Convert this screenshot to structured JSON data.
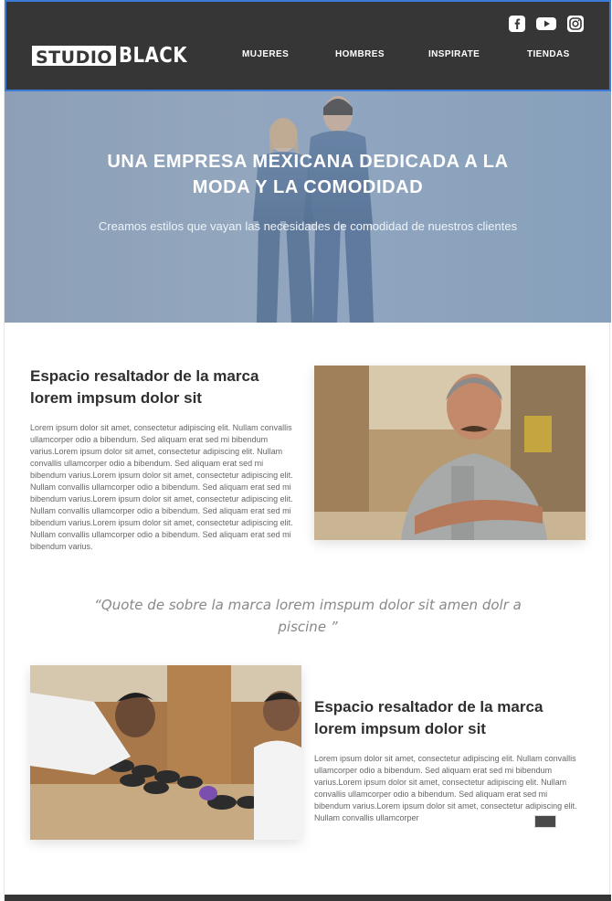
{
  "brand": {
    "logo_boxed": "STUDIO",
    "logo_rest": "BLACK"
  },
  "social": [
    {
      "name": "facebook-icon"
    },
    {
      "name": "youtube-icon"
    },
    {
      "name": "instagram-icon"
    }
  ],
  "nav": {
    "items": [
      "MUJERES",
      "HOMBRES",
      "INSPIRATE",
      "TIENDAS"
    ]
  },
  "hero": {
    "title_line1": "UNA EMPRESA MEXICANA DEDICADA A LA",
    "title_line2": "MODA Y LA COMODIDAD",
    "subtitle": "Creamos estilos que vayan las necesidades de comodidad de nuestros clientes"
  },
  "section1": {
    "heading_line1": "Espacio resaltador de la marca",
    "heading_line2": "lorem impsum dolor sit",
    "body": "Lorem ipsum dolor sit amet, consectetur adipiscing elit. Nullam convallis ullamcorper odio a bibendum. Sed aliquam erat sed mi bibendum varius.Lorem ipsum dolor sit amet, consectetur adipiscing elit. Nullam convallis ullamcorper odio a bibendum. Sed aliquam erat sed mi bibendum varius.Lorem ipsum dolor sit amet, consectetur adipiscing elit. Nullam convallis ullamcorper odio a bibendum. Sed aliquam erat sed mi bibendum varius.Lorem ipsum dolor sit amet, consectetur adipiscing elit. Nullam convallis ullamcorper odio a bibendum. Sed aliquam erat sed mi bibendum varius.Lorem ipsum dolor sit amet, consectetur adipiscing elit. Nullam convallis ullamcorper odio a bibendum. Sed aliquam erat sed mi bibendum varius."
  },
  "quote": {
    "line1": "“Quote de sobre la marca lorem imspum dolor sit amen dolr a",
    "line2": "piscine ”"
  },
  "section2": {
    "heading_line1": "Espacio resaltador de la marca",
    "heading_line2": "lorem impsum dolor sit",
    "body": "Lorem ipsum dolor sit amet, consectetur adipiscing elit. Nullam convallis ullamcorper odio a bibendum. Sed aliquam erat sed mi bibendum varius.Lorem ipsum dolor sit amet, consectetur adipiscing elit. Nullam convallis ullamcorper odio a bibendum. Sed aliquam erat sed mi bibendum varius.Lorem ipsum dolor sit amet, consectetur adipiscing elit. Nullam convallis ullamcorper"
  },
  "colors": {
    "header_bg": "#363636",
    "header_border": "#3d7bd9",
    "hero_bg": "#8ea2bb",
    "heading_text": "#2f2f2f",
    "body_text": "#666666",
    "quote_text": "#888888"
  }
}
